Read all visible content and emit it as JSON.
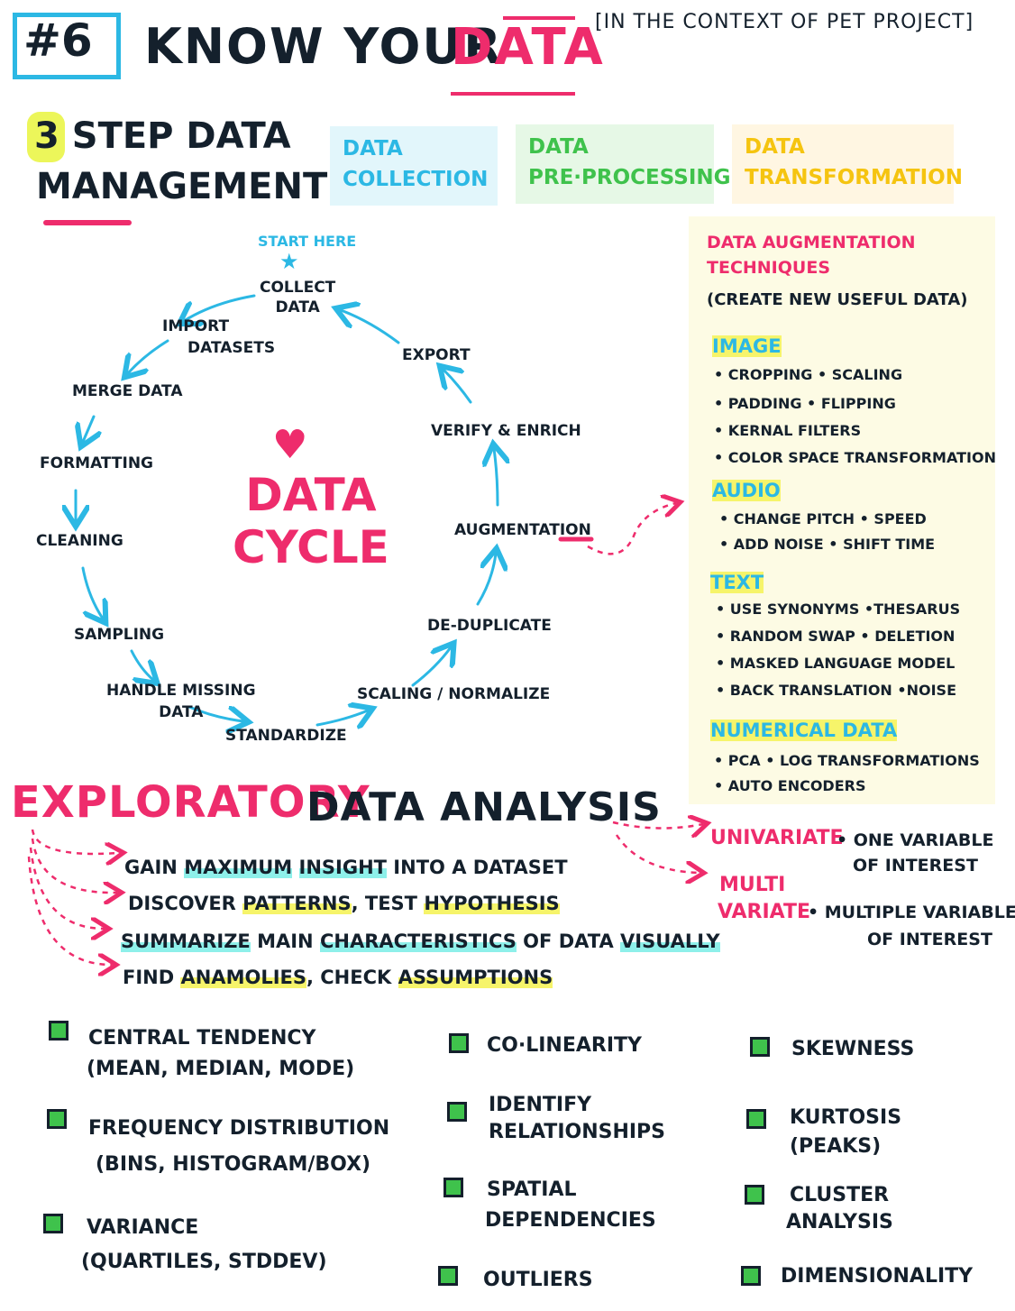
{
  "header": {
    "number": "#6",
    "title_main": "KNOW YOUR",
    "title_accent": "DATA",
    "context": "[IN THE CONTEXT OF PET PROJECT]"
  },
  "steps": {
    "line1": "3 STEP DATA",
    "line2": "MANAGEMENT",
    "boxes": [
      {
        "l1": "DATA",
        "l2": "COLLECTION"
      },
      {
        "l1": "DATA",
        "l2": "PRE·PROCESSING"
      },
      {
        "l1": "DATA",
        "l2": "TRANSFORMATION"
      }
    ]
  },
  "cycle": {
    "start_here": "START HERE",
    "title_l1": "DATA",
    "title_l2": "CYCLE",
    "nodes": {
      "collect_l1": "COLLECT",
      "collect_l2": "DATA",
      "import_l1": "IMPORT",
      "import_l2": "DATASETS",
      "merge": "MERGE DATA",
      "formatting": "FORMATTING",
      "cleaning": "CLEANING",
      "sampling": "SAMPLING",
      "handle_l1": "HANDLE MISSING",
      "handle_l2": "DATA",
      "standardize": "STANDARDIZE",
      "scaling": "SCALING / NORMALIZE",
      "dedup": "DE-DUPLICATE",
      "augmentation": "AUGMENTATION",
      "verify": "VERIFY & ENRICH",
      "export": "EXPORT"
    }
  },
  "augmentation": {
    "title_l1": "DATA AUGMENTATION",
    "title_l2": "TECHNIQUES",
    "subtitle": "(CREATE NEW USEFUL DATA)",
    "image": {
      "label": "IMAGE",
      "items": [
        "• CROPPING  • SCALING",
        "• PADDING  • FLIPPING",
        "• KERNAL FILTERS",
        "• COLOR SPACE TRANSFORMATION"
      ]
    },
    "audio": {
      "label": "AUDIO",
      "items": [
        "• CHANGE PITCH  • SPEED",
        "• ADD NOISE  • SHIFT TIME"
      ]
    },
    "text": {
      "label": "TEXT",
      "items": [
        "• USE SYNONYMS  •THESARUS",
        "• RANDOM SWAP  • DELETION",
        "• MASKED LANGUAGE MODEL",
        "• BACK TRANSLATION •NOISE"
      ]
    },
    "numerical": {
      "label": "NUMERICAL DATA",
      "items": [
        "• PCA  • LOG TRANSFORMATIONS",
        "• AUTO ENCODERS"
      ]
    }
  },
  "eda": {
    "word1": "EXPLORATORY",
    "word2": "DATA ANALYSIS",
    "goal1": {
      "a": "GAIN ",
      "b": "MAXIMUM",
      "c": " ",
      "d": "INSIGHT",
      "e": " INTO A DATASET"
    },
    "goal2": {
      "a": "DISCOVER ",
      "b": "PATTERNS",
      "c": ", TEST ",
      "d": "HYPOTHESIS"
    },
    "goal3": {
      "a": "SUMMARIZE",
      "b": " MAIN ",
      "c": "CHARACTERISTICS",
      "d": " OF DATA ",
      "e": "VISUALLY"
    },
    "goal4": {
      "a": "FIND ",
      "b": "ANAMOLIES",
      "c": ", CHECK ",
      "d": "ASSUMPTIONS"
    },
    "univariate": {
      "label": "UNIVARIATE",
      "desc1": "• ONE VARIABLE",
      "desc2": "OF INTEREST"
    },
    "multivariate": {
      "label1": "MULTI",
      "label2": "VARIATE",
      "desc1": "• MULTIPLE VARIABLES",
      "desc2": "OF INTEREST"
    }
  },
  "checklist": {
    "col1": [
      {
        "l1": "CENTRAL TENDENCY",
        "l2": "(MEAN, MEDIAN, MODE)"
      },
      {
        "l1": "FREQUENCY DISTRIBUTION",
        "l2": "(BINS, HISTOGRAM/BOX)"
      },
      {
        "l1": "VARIANCE",
        "l2": "(QUARTILES, STDDEV)"
      }
    ],
    "col2": [
      {
        "l1": "CO·LINEARITY",
        "l2": ""
      },
      {
        "l1": "IDENTIFY",
        "l2": "RELATIONSHIPS"
      },
      {
        "l1": "SPATIAL",
        "l2": "DEPENDENCIES"
      },
      {
        "l1": "OUTLIERS",
        "l2": ""
      }
    ],
    "col3": [
      {
        "l1": "SKEWNESS",
        "l2": ""
      },
      {
        "l1": "KURTOSIS",
        "l2": "(PEAKS)"
      },
      {
        "l1": "CLUSTER",
        "l2": "ANALYSIS"
      },
      {
        "l1": "DIMENSIONALITY",
        "l2": ""
      }
    ]
  },
  "colors": {
    "ink": "#14202c",
    "pink": "#ee2c6c",
    "cyan": "#2cb8e4",
    "green": "#3fc24c",
    "yellow": "#f5c410"
  }
}
